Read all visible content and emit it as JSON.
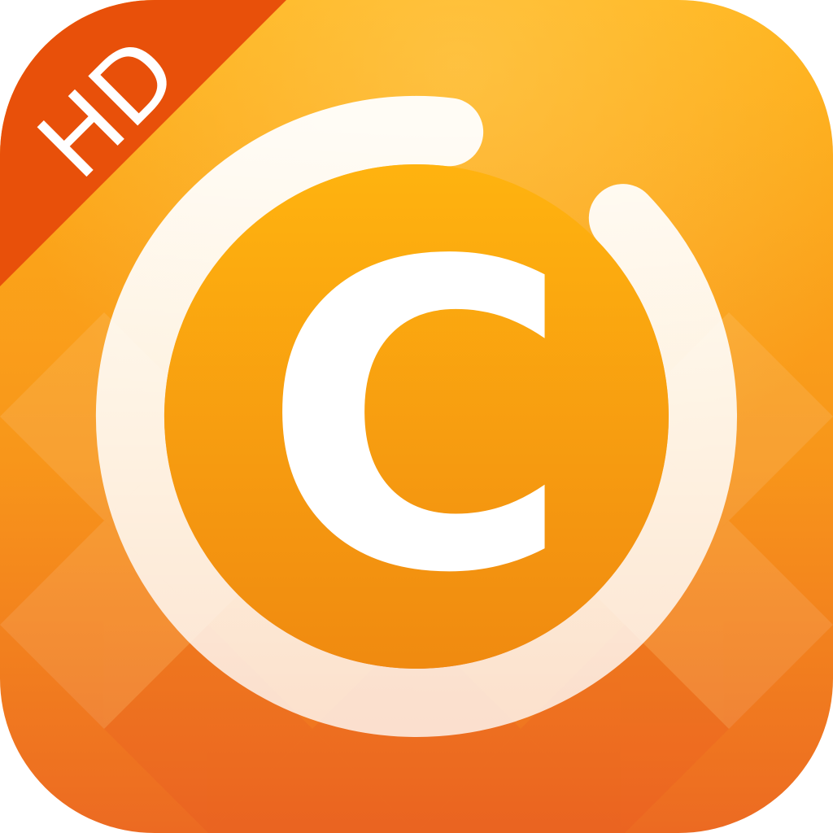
{
  "app_icon": {
    "badge": {
      "text": "HD",
      "color": "#E8500A",
      "text_color": "#FFFFFF"
    },
    "logo": {
      "letter": "C",
      "letter_color": "#FFFFFF"
    },
    "progress_ring": {
      "progress": 0.89,
      "color": "#FFFFFF"
    },
    "colors": {
      "gradient_top": "#FFB318",
      "gradient_mid": "#F8961A",
      "gradient_bottom": "#EC6A22",
      "inner_top": "#FFB30F",
      "inner_bottom": "#F08A10"
    }
  }
}
